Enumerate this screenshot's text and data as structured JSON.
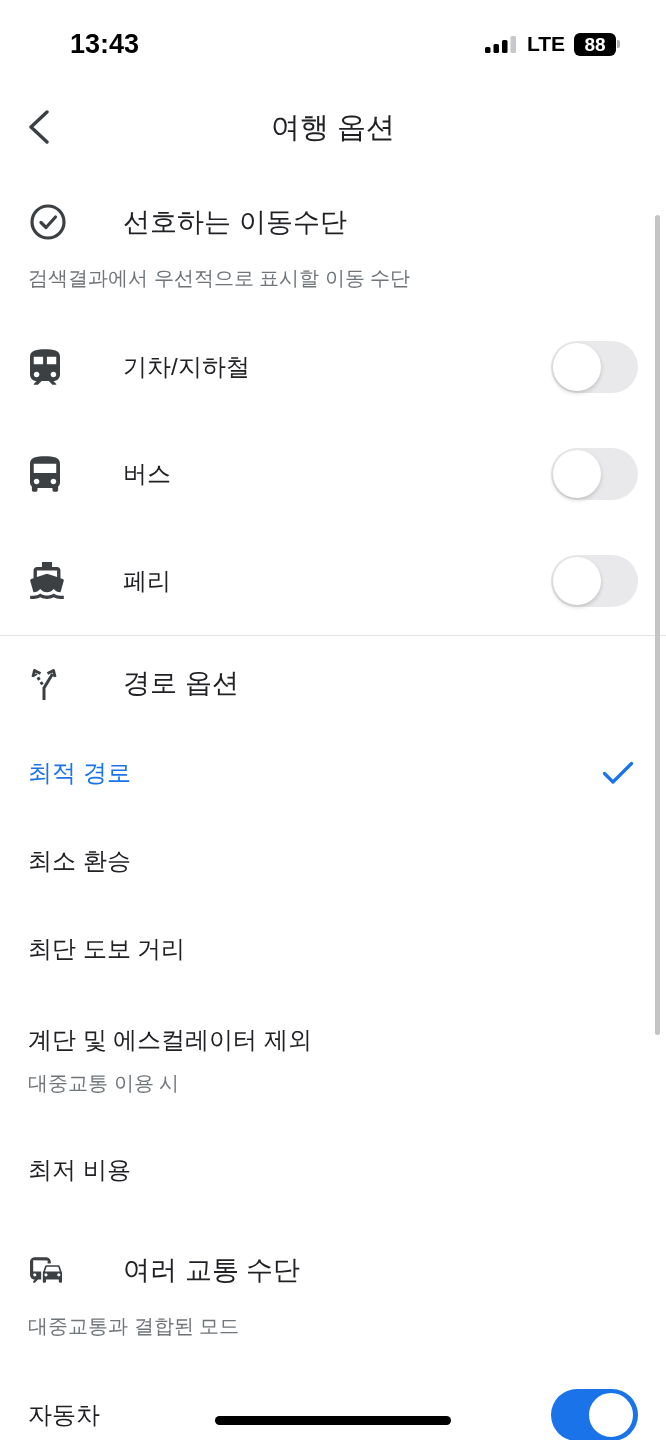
{
  "status_bar": {
    "time": "13:43",
    "network": "LTE",
    "battery": "88"
  },
  "header": {
    "title": "여행 옵션"
  },
  "sections": [
    {
      "kind": "toggles",
      "title": "선호하는 이동수단",
      "subtitle": "검색결과에서 우선적으로 표시할 이동 수단",
      "divider_after": true,
      "items": [
        {
          "label": "기차/지하철",
          "on": false
        },
        {
          "label": "버스",
          "on": false
        },
        {
          "label": "페리",
          "on": false
        }
      ]
    },
    {
      "kind": "choices",
      "title": "경로 옵션",
      "items": [
        {
          "label": "최적 경로",
          "selected": true
        },
        {
          "label": "최소 환승",
          "selected": false
        },
        {
          "label": "최단 도보 거리",
          "selected": false
        },
        {
          "label": "계단 및 에스컬레이터 제외",
          "subtitle": "대중교통 이용 시",
          "selected": false
        },
        {
          "label": "최저 비용",
          "selected": false
        }
      ]
    },
    {
      "kind": "toggles",
      "title": "여러 교통 수단",
      "subtitle": "대중교통과 결합된 모드",
      "items": [
        {
          "label": "자동차",
          "on": true
        }
      ]
    }
  ]
}
